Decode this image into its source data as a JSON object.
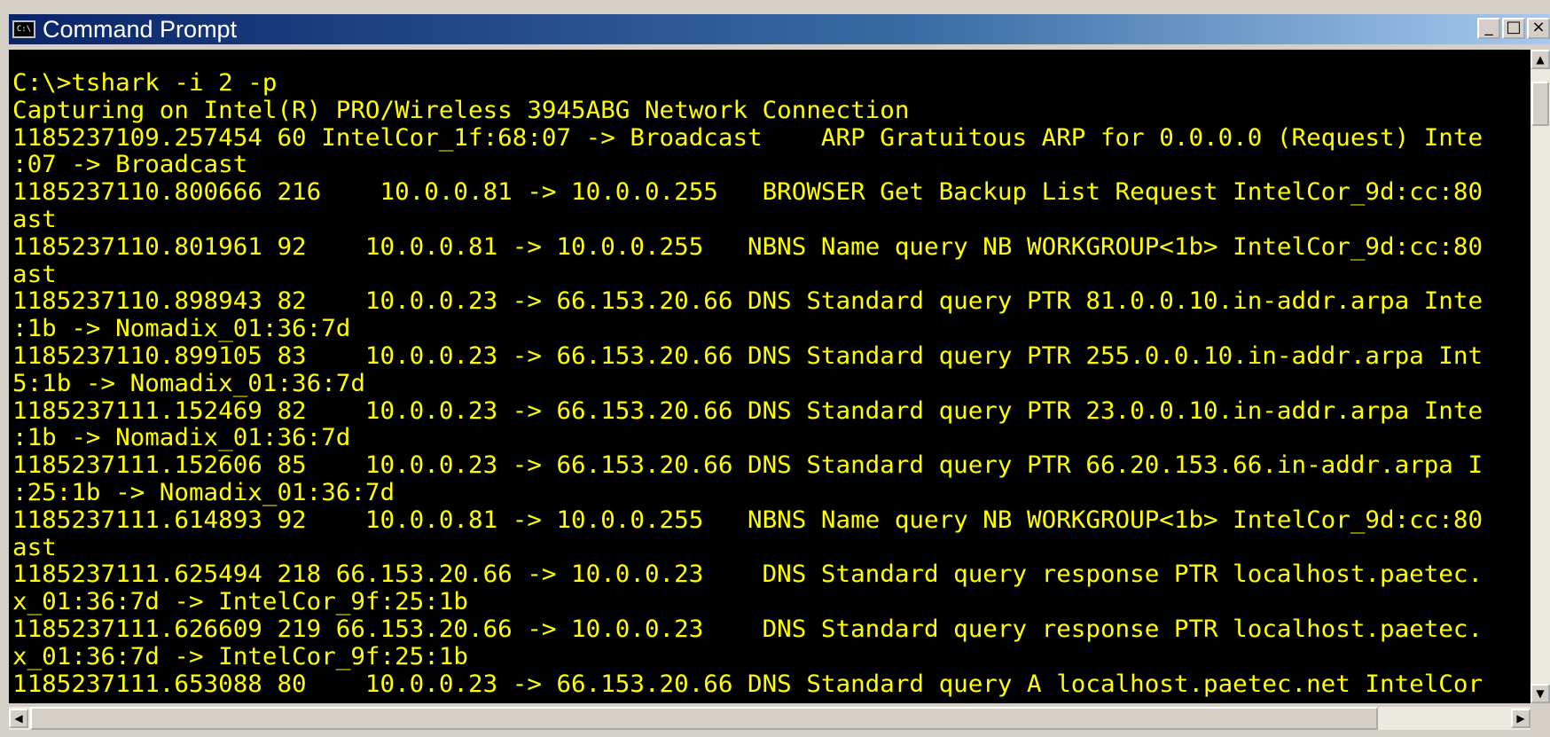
{
  "window": {
    "title": "Command Prompt",
    "icon_text": "C:\\",
    "buttons": {
      "minimize": "_",
      "maximize": "□",
      "close": "×"
    }
  },
  "console": {
    "text_color": "#ffff00",
    "background": "#000000",
    "lines": [
      "C:\\>tshark -i 2 -p",
      "Capturing on Intel(R) PRO/Wireless 3945ABG Network Connection",
      "1185237109.257454 60 IntelCor_1f:68:07 -> Broadcast    ARP Gratuitous ARP for 0.0.0.0 (Request) Inte",
      ":07 -> Broadcast",
      "1185237110.800666 216    10.0.0.81 -> 10.0.0.255   BROWSER Get Backup List Request IntelCor_9d:cc:80",
      "ast",
      "1185237110.801961 92    10.0.0.81 -> 10.0.0.255   NBNS Name query NB WORKGROUP<1b> IntelCor_9d:cc:80",
      "ast",
      "1185237110.898943 82    10.0.0.23 -> 66.153.20.66 DNS Standard query PTR 81.0.0.10.in-addr.arpa Inte",
      ":1b -> Nomadix_01:36:7d",
      "1185237110.899105 83    10.0.0.23 -> 66.153.20.66 DNS Standard query PTR 255.0.0.10.in-addr.arpa Int",
      "5:1b -> Nomadix_01:36:7d",
      "1185237111.152469 82    10.0.0.23 -> 66.153.20.66 DNS Standard query PTR 23.0.0.10.in-addr.arpa Inte",
      ":1b -> Nomadix_01:36:7d",
      "1185237111.152606 85    10.0.0.23 -> 66.153.20.66 DNS Standard query PTR 66.20.153.66.in-addr.arpa I",
      ":25:1b -> Nomadix_01:36:7d",
      "1185237111.614893 92    10.0.0.81 -> 10.0.0.255   NBNS Name query NB WORKGROUP<1b> IntelCor_9d:cc:80",
      "ast",
      "1185237111.625494 218 66.153.20.66 -> 10.0.0.23    DNS Standard query response PTR localhost.paetec.",
      "x_01:36:7d -> IntelCor_9f:25:1b",
      "1185237111.626609 219 66.153.20.66 -> 10.0.0.23    DNS Standard query response PTR localhost.paetec.",
      "x_01:36:7d -> IntelCor_9f:25:1b",
      "1185237111.653088 80    10.0.0.23 -> 66.153.20.66 DNS Standard query A localhost.paetec.net IntelCor"
    ]
  },
  "scrollbars": {
    "up": "▲",
    "down": "▼",
    "left": "◀",
    "right": "▶"
  }
}
